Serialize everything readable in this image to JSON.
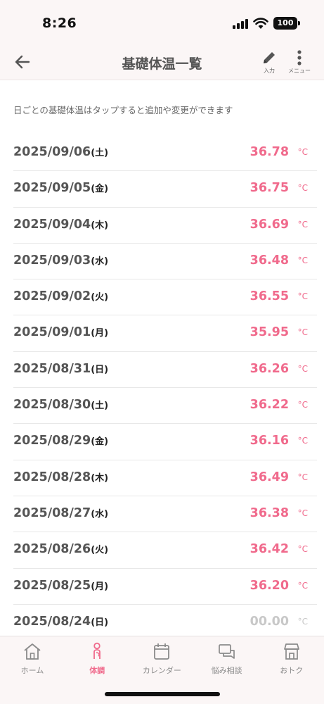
{
  "status_bar": {
    "time": "8:26",
    "battery": "100"
  },
  "header": {
    "title": "基礎体温一覧",
    "input_label": "入力",
    "menu_label": "メニュー"
  },
  "hint": "日ごとの基礎体温はタップすると追加や変更ができます",
  "colors": {
    "accent": "#f06a8c",
    "empty": "#c8c8c8",
    "text": "#555555",
    "tab_inactive": "#8a8a8a"
  },
  "records": [
    {
      "date": "2025/09/06",
      "weekday": "(土)",
      "temp": "36.78",
      "unit": "°C",
      "empty": false
    },
    {
      "date": "2025/09/05",
      "weekday": "(金)",
      "temp": "36.75",
      "unit": "°C",
      "empty": false
    },
    {
      "date": "2025/09/04",
      "weekday": "(木)",
      "temp": "36.69",
      "unit": "°C",
      "empty": false
    },
    {
      "date": "2025/09/03",
      "weekday": "(水)",
      "temp": "36.48",
      "unit": "°C",
      "empty": false
    },
    {
      "date": "2025/09/02",
      "weekday": "(火)",
      "temp": "36.55",
      "unit": "°C",
      "empty": false
    },
    {
      "date": "2025/09/01",
      "weekday": "(月)",
      "temp": "35.95",
      "unit": "°C",
      "empty": false
    },
    {
      "date": "2025/08/31",
      "weekday": "(日)",
      "temp": "36.26",
      "unit": "°C",
      "empty": false
    },
    {
      "date": "2025/08/30",
      "weekday": "(土)",
      "temp": "36.22",
      "unit": "°C",
      "empty": false
    },
    {
      "date": "2025/08/29",
      "weekday": "(金)",
      "temp": "36.16",
      "unit": "°C",
      "empty": false
    },
    {
      "date": "2025/08/28",
      "weekday": "(木)",
      "temp": "36.49",
      "unit": "°C",
      "empty": false
    },
    {
      "date": "2025/08/27",
      "weekday": "(水)",
      "temp": "36.38",
      "unit": "°C",
      "empty": false
    },
    {
      "date": "2025/08/26",
      "weekday": "(火)",
      "temp": "36.42",
      "unit": "°C",
      "empty": false
    },
    {
      "date": "2025/08/25",
      "weekday": "(月)",
      "temp": "36.20",
      "unit": "°C",
      "empty": false
    },
    {
      "date": "2025/08/24",
      "weekday": "(日)",
      "temp": "00.00",
      "unit": "°C",
      "empty": true
    }
  ],
  "tabs": [
    {
      "label": "ホーム",
      "icon": "home-icon",
      "active": false
    },
    {
      "label": "体調",
      "icon": "body-icon",
      "active": true
    },
    {
      "label": "カレンダー",
      "icon": "calendar-icon",
      "active": false
    },
    {
      "label": "悩み相談",
      "icon": "chat-icon",
      "active": false
    },
    {
      "label": "おトク",
      "icon": "shop-icon",
      "active": false
    }
  ]
}
